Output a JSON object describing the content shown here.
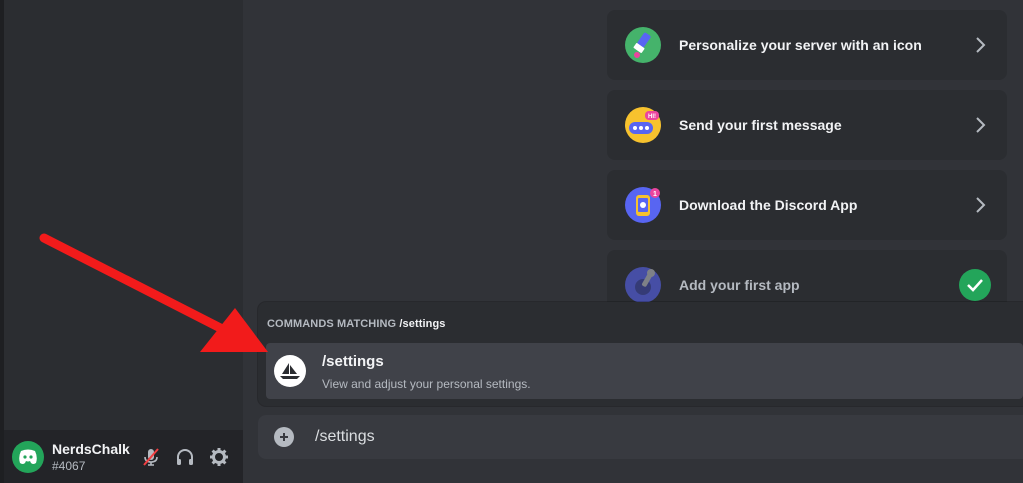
{
  "checklist": [
    {
      "label": "Personalize your server with an icon",
      "icon": "paintbrush-icon",
      "color": "#3ba55c",
      "completed": false
    },
    {
      "label": "Send your first message",
      "icon": "chat-bubble-icon",
      "color": "#faa81a",
      "completed": false
    },
    {
      "label": "Download the Discord App",
      "icon": "phone-icon",
      "color": "#5865f2",
      "completed": false
    },
    {
      "label": "Add your first app",
      "icon": "wrench-icon",
      "color": "#5865f2",
      "completed": true
    }
  ],
  "autocomplete": {
    "header_prefix": "COMMANDS MATCHING",
    "header_query": "/settings",
    "option": {
      "name": "/settings",
      "description": "View and adjust your personal settings."
    }
  },
  "chat_input": {
    "value": "/settings"
  },
  "user_panel": {
    "username": "NerdsChalk",
    "discriminator": "#4067",
    "mic_muted": true
  },
  "colors": {
    "accent": "#5865f2",
    "success": "#23a55a",
    "annotation_arrow": "#f21b1b"
  }
}
